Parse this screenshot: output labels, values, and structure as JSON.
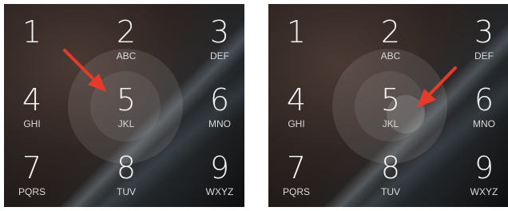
{
  "panels": [
    {
      "keys": [
        {
          "digit": "1",
          "letters": ""
        },
        {
          "digit": "2",
          "letters": "ABC"
        },
        {
          "digit": "3",
          "letters": "DEF"
        },
        {
          "digit": "4",
          "letters": "GHI"
        },
        {
          "digit": "5",
          "letters": "JKL"
        },
        {
          "digit": "6",
          "letters": "MNO"
        },
        {
          "digit": "7",
          "letters": "PQRS"
        },
        {
          "digit": "8",
          "letters": "TUV"
        },
        {
          "digit": "9",
          "letters": "WXYZ"
        }
      ]
    },
    {
      "keys": [
        {
          "digit": "1",
          "letters": ""
        },
        {
          "digit": "2",
          "letters": "ABC"
        },
        {
          "digit": "3",
          "letters": "DEF"
        },
        {
          "digit": "4",
          "letters": "GHI"
        },
        {
          "digit": "5",
          "letters": "JKL"
        },
        {
          "digit": "6",
          "letters": "MNO"
        },
        {
          "digit": "7",
          "letters": "PQRS"
        },
        {
          "digit": "8",
          "letters": "TUV"
        },
        {
          "digit": "9",
          "letters": "WXYZ"
        }
      ]
    }
  ],
  "colors": {
    "arrow": "#e83a2a",
    "text": "#f3f3f3"
  },
  "icons": {
    "pointer": "red-arrow-icon"
  }
}
